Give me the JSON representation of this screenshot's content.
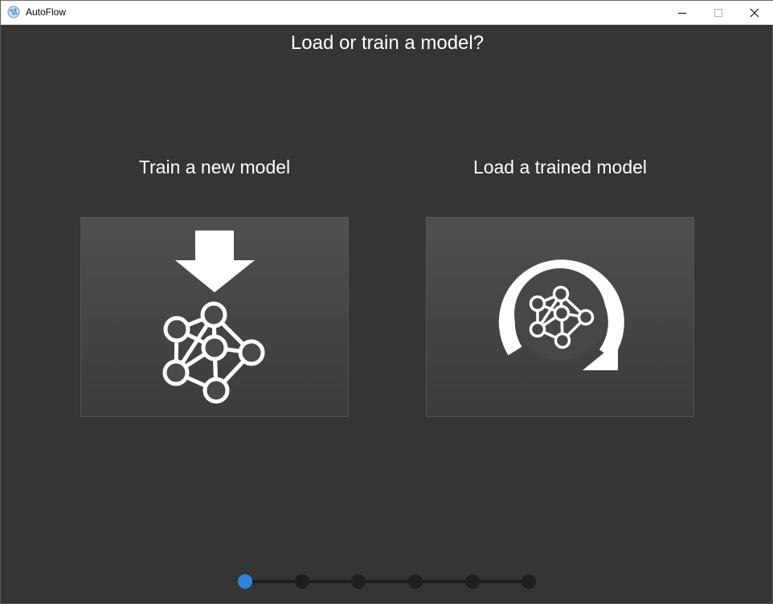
{
  "window": {
    "title": "AutoFlow",
    "icon": "autoflow-logo-icon"
  },
  "page": {
    "title": "Load or train a model?"
  },
  "options": {
    "train": {
      "label": "Train a new model",
      "icon": "download-network-icon"
    },
    "load": {
      "label": "Load a trained model",
      "icon": "reload-network-icon"
    }
  },
  "stepper": {
    "total_steps": 6,
    "current_step": 1,
    "active_color": "#2f84d6",
    "inactive_color": "#1e1e1e"
  }
}
